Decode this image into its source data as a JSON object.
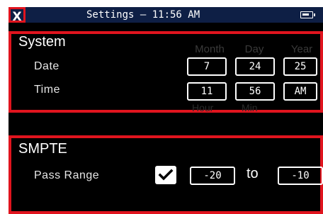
{
  "title_bar": {
    "close_label": "X",
    "title": "Settings — 11:56 AM",
    "battery_icon": "battery-icon"
  },
  "system": {
    "title": "System",
    "headers": {
      "month": "Month",
      "day": "Day",
      "year": "Year"
    },
    "date": {
      "label": "Date",
      "month": "7",
      "day": "24",
      "year": "25"
    },
    "time": {
      "label": "Time",
      "hour": "11",
      "min": "56",
      "ampm": "AM"
    },
    "sub_headers": {
      "hour": "Hour",
      "min": "Min"
    }
  },
  "smpte": {
    "title": "SMPTE",
    "pass_range": {
      "label": "Pass Range",
      "checked": true,
      "from": "-20",
      "to_label": "to",
      "to": "-10"
    }
  },
  "colors": {
    "highlight": "#e0141e",
    "title_bar": "#0e1f45",
    "background": "#000000"
  }
}
